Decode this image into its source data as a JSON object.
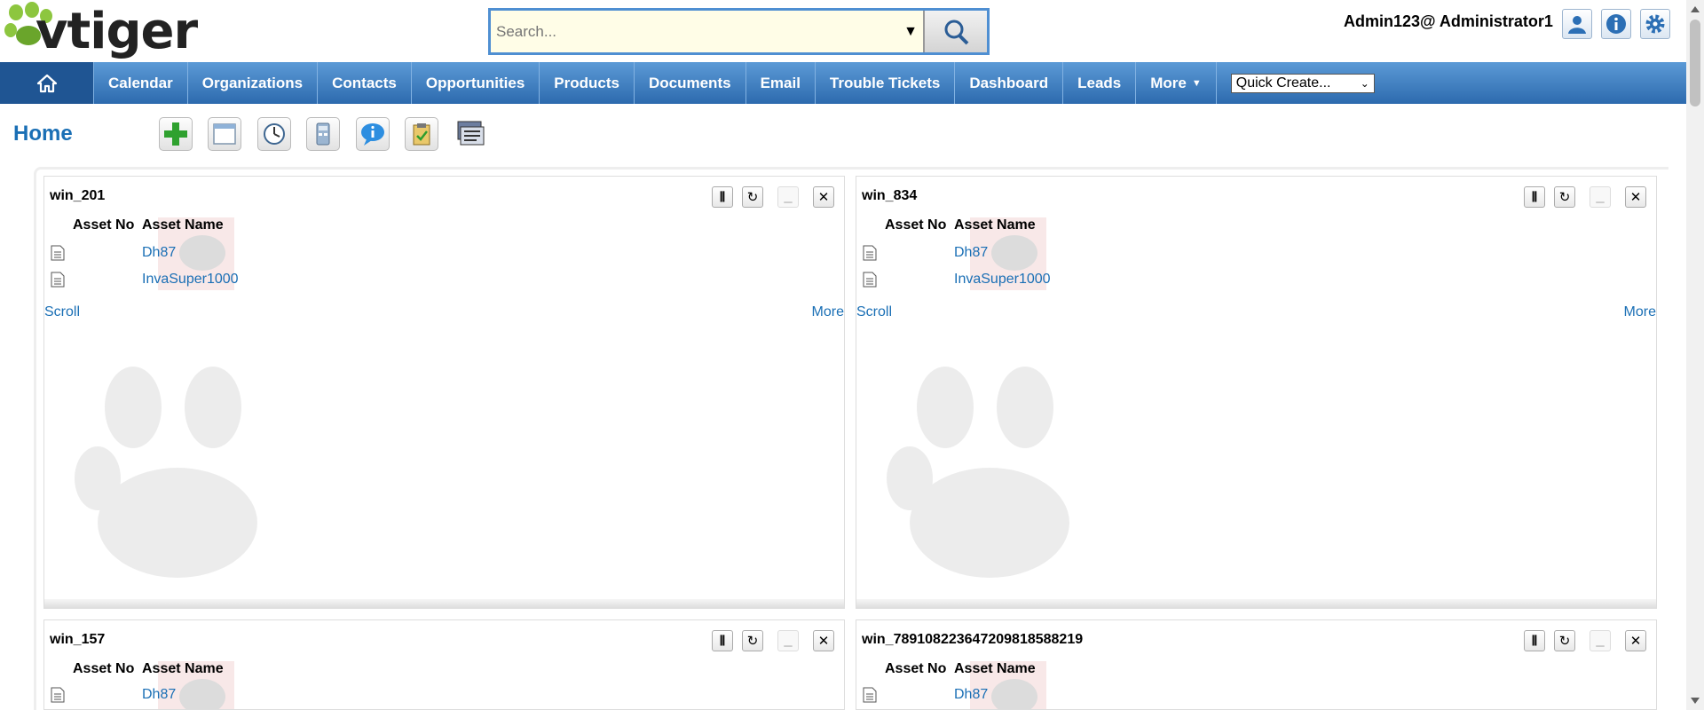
{
  "header": {
    "logo_text": "vtiger",
    "search_placeholder": "Search...",
    "user_label": "Admin123@ Administrator1",
    "icons": [
      "user-profile-icon",
      "info-icon",
      "settings-gear-icon"
    ]
  },
  "nav": {
    "home_icon": "home-icon",
    "items": [
      "Calendar",
      "Organizations",
      "Contacts",
      "Opportunities",
      "Products",
      "Documents",
      "Email",
      "Trouble Tickets",
      "Dashboard",
      "Leads",
      "More"
    ],
    "quick_create": "Quick Create..."
  },
  "page": {
    "title": "Home",
    "toolbar_icons": [
      "add-widget-icon",
      "calendar-window-icon",
      "clock-icon",
      "calculator-icon",
      "chat-info-icon",
      "clipboard-icon",
      "layout-icon"
    ]
  },
  "widgets": [
    {
      "title": "win_201",
      "col1": "Asset No",
      "col2": "Asset Name",
      "rows": [
        "Dh87",
        "InvaSuper1000"
      ],
      "scroll": "Scroll",
      "more": "More"
    },
    {
      "title": "win_834",
      "col1": "Asset No",
      "col2": "Asset Name",
      "rows": [
        "Dh87",
        "InvaSuper1000"
      ],
      "scroll": "Scroll",
      "more": "More"
    },
    {
      "title": "win_157",
      "col1": "Asset No",
      "col2": "Asset Name",
      "rows": [
        "Dh87"
      ]
    },
    {
      "title": "win_78910822364720981858821​9",
      "col1": "Asset No",
      "col2": "Asset Name",
      "rows": [
        "Dh87"
      ]
    }
  ],
  "colors": {
    "nav_bg": "#2d6aae",
    "link": "#1a6fb5",
    "search_border": "#4f8fd2"
  }
}
